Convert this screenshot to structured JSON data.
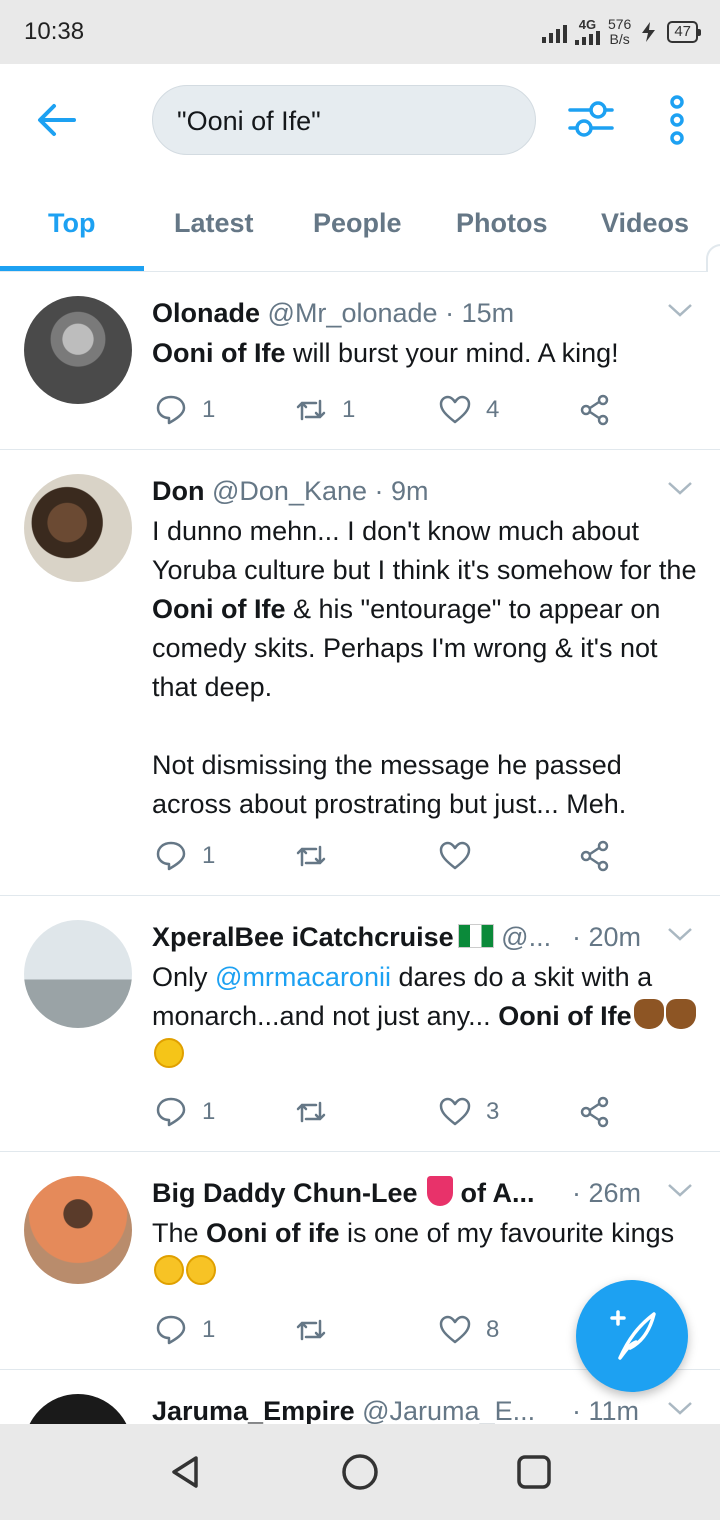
{
  "status_bar": {
    "time": "10:38",
    "network": "4G",
    "speed_value": "576",
    "speed_unit": "B/s",
    "battery": "47"
  },
  "header": {
    "search_query": "\"Ooni of Ife\"",
    "icons": [
      "back-arrow-icon",
      "filter-sliders-icon",
      "more-vertical-icon"
    ],
    "accent_color": "#1da1f2"
  },
  "tabs": [
    {
      "label": "Top",
      "active": true
    },
    {
      "label": "Latest",
      "active": false
    },
    {
      "label": "People",
      "active": false
    },
    {
      "label": "Photos",
      "active": false
    },
    {
      "label": "Videos",
      "active": false
    }
  ],
  "tweets": [
    {
      "name": "Olonade",
      "handle": "@Mr_olonade",
      "time": "15m",
      "text_bold": "Ooni of Ife",
      "text_rest": " will burst your mind. A king!",
      "replies": "1",
      "retweets": "1",
      "likes": "4"
    },
    {
      "name": "Don",
      "handle": "@Don_Kane",
      "time": "9m",
      "text_1": "I dunno mehn... I don't know much about Yoruba culture but I think it's somehow for the ",
      "text_bold": "Ooni of Ife",
      "text_2": " & his \"entourage\" to appear on comedy skits. Perhaps I'm wrong & it's not that deep.",
      "text_3": "Not dismissing the message he passed across about prostrating but just... Meh.",
      "replies": "1",
      "retweets": "",
      "likes": ""
    },
    {
      "name": "XperalBee iCatchcruise",
      "handle": "@...",
      "time": "20m",
      "text_1": "Only ",
      "mention": "@mrmacaronii",
      "text_2": " dares do a skit with a monarch...and not just any... ",
      "text_bold": "Ooni of Ife",
      "replies": "1",
      "retweets": "",
      "likes": "3"
    },
    {
      "name": "Big Daddy Chun-Lee",
      "name_suffix": "of A...",
      "time": "26m",
      "text_1": "The ",
      "text_bold": "Ooni of ife",
      "text_2": " is one of my favourite kings",
      "replies": "1",
      "retweets": "",
      "likes": "8"
    },
    {
      "name": "Jaruma_Empire",
      "handle": "@Jaruma_E...",
      "time": "11m"
    }
  ],
  "fab": {
    "icon": "compose-tweet-icon"
  },
  "navbar": {
    "icons": [
      "nav-back-icon",
      "nav-home-icon",
      "nav-recents-icon"
    ]
  }
}
